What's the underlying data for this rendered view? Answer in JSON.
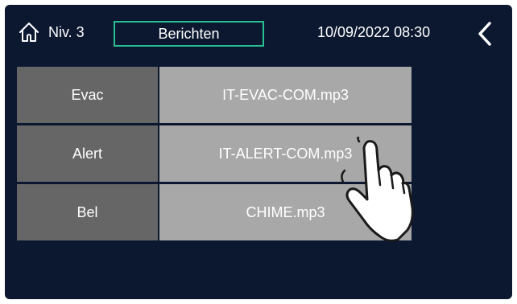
{
  "header": {
    "level": "Niv. 3",
    "title": "Berichten",
    "datetime": "10/09/2022 08:30"
  },
  "messages": [
    {
      "label": "Evac",
      "file": "IT-EVAC-COM.mp3"
    },
    {
      "label": "Alert",
      "file": "IT-ALERT-COM.mp3"
    },
    {
      "label": "Bel",
      "file": "CHIME.mp3"
    }
  ],
  "icons": {
    "home": "home-icon",
    "back": "chevron-left-icon",
    "pointer": "hand-pointer-icon"
  },
  "colors": {
    "background": "#0c1830",
    "title_border": "#28c090",
    "label_cell": "#666666",
    "file_cell": "#a8a8a8"
  }
}
